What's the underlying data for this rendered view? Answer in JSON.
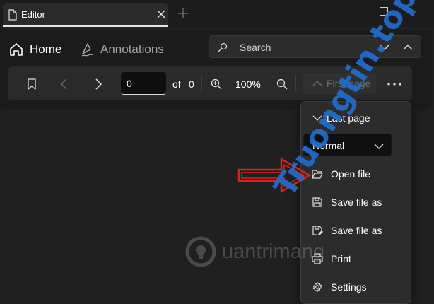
{
  "window": {
    "tab_title": "Editor"
  },
  "ribbon": {
    "tabs": [
      {
        "label": "Home"
      },
      {
        "label": "Annotations"
      }
    ],
    "search": {
      "placeholder": "Search"
    }
  },
  "toolbar": {
    "page_value": "0",
    "of_label": "of",
    "total_pages": "0",
    "zoom": "100%",
    "first_page_label": "First page"
  },
  "menu": {
    "last_page_label": "Last page",
    "mode_value": "Normal",
    "items": [
      {
        "label": "Open file",
        "icon": "folder-open-icon"
      },
      {
        "label": "Save file as",
        "icon": "save-icon"
      },
      {
        "label": "Save file as",
        "icon": "save-edit-icon"
      },
      {
        "label": "Print",
        "icon": "printer-icon"
      },
      {
        "label": "Settings",
        "icon": "gear-icon"
      }
    ]
  },
  "watermarks": {
    "quantrimang": "uantrimang",
    "truongtin": "Truongtin.top"
  },
  "colors": {
    "background": "#202020",
    "arrow": "#e0201b",
    "watermark_blue": "#1f6fd1",
    "watermark_orange": "#f28c1c"
  }
}
